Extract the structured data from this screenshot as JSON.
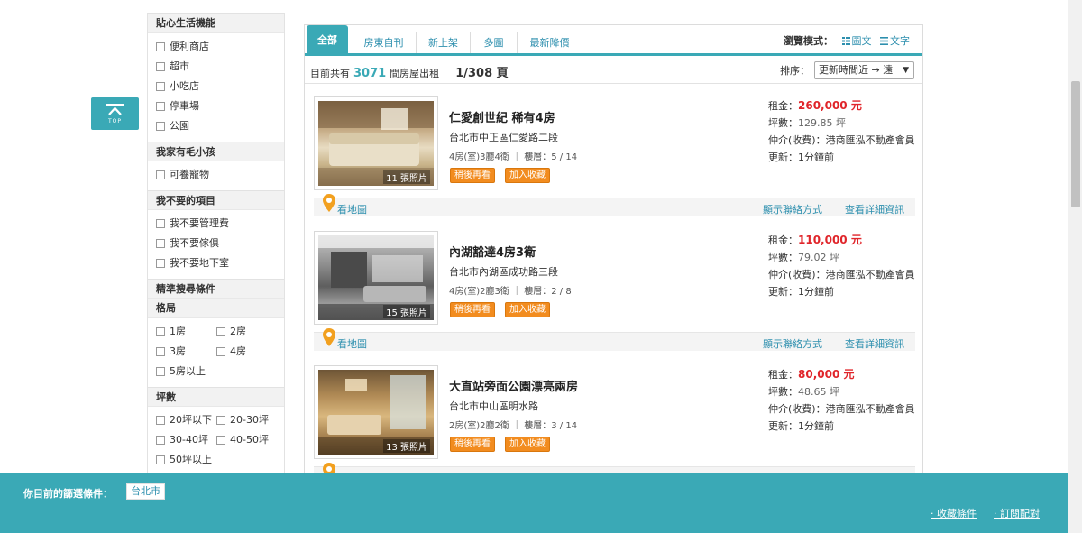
{
  "top_button": {
    "label": "TOP"
  },
  "sidebar": {
    "sections": [
      {
        "title": "貼心生活機能",
        "options": [
          "便利商店",
          "超市",
          "小吃店",
          "停車場",
          "公園"
        ]
      },
      {
        "title": "我家有毛小孩",
        "options": [
          "可養寵物"
        ]
      },
      {
        "title": "我不要的項目",
        "options": [
          "我不要管理費",
          "我不要傢俱",
          "我不要地下室"
        ]
      }
    ],
    "precise_title": "精準搜尋條件",
    "layout": {
      "title": "格局",
      "options": [
        "1房",
        "2房",
        "3房",
        "4房",
        "5房以上"
      ]
    },
    "area": {
      "title": "坪數",
      "options": [
        "20坪以下",
        "20-30坪",
        "30-40坪",
        "40-50坪",
        "50坪以上"
      ]
    }
  },
  "tabs": [
    "全部",
    "房東自刊",
    "新上架",
    "多圖",
    "最新降價"
  ],
  "view_mode": {
    "label": "瀏覽模式：",
    "options": [
      "圖文",
      "文字"
    ]
  },
  "summary": {
    "prefix": "目前共有",
    "count": "3071",
    "suffix": "間房屋出租",
    "pages": "1/308 頁"
  },
  "sort": {
    "label": "排序：",
    "selected": "更新時間近 → 遠"
  },
  "listing_labels": {
    "rent": "租金：",
    "area": "坪數：",
    "agent": "仲介(收費)：",
    "updated": "更新：",
    "later": "稍後再看",
    "fav": "加入收藏",
    "map": "看地圖",
    "contact": "顯示聯絡方式",
    "detail": "查看詳細資訊",
    "price_unit": "元",
    "area_unit": "坪"
  },
  "listings": [
    {
      "title": "仁愛創世紀 稀有4房",
      "address": "台北市中正區仁愛路二段",
      "layout": "4房(室)3廳4衛",
      "floor": "樓層：5 / 14",
      "photos": "11 張照片",
      "price": "260,000",
      "area": "129.85",
      "agent": "港商匯泓不動產會員",
      "updated": "1分鐘前"
    },
    {
      "title": "內湖豁達4房3衛",
      "address": "台北市內湖區成功路三段",
      "layout": "4房(室)2廳3衛",
      "floor": "樓層：2 / 8",
      "photos": "15 張照片",
      "price": "110,000",
      "area": "79.02",
      "agent": "港商匯泓不動產會員",
      "updated": "1分鐘前"
    },
    {
      "title": "大直站旁面公園漂亮兩房",
      "address": "台北市中山區明水路",
      "layout": "2房(室)2廳2衛",
      "floor": "樓層：3 / 14",
      "photos": "13 張照片",
      "price": "80,000",
      "area": "48.65",
      "agent": "港商匯泓不動產會員",
      "updated": "1分鐘前"
    }
  ],
  "bottom_bar": {
    "label": "你目前的篩選條件：",
    "tag": "台北市",
    "links": [
      "收藏條件",
      "訂閱配對"
    ]
  },
  "colors": {
    "accent": "#3aa9b6",
    "link": "#2d8fae",
    "price": "#e0252a",
    "orange": "#f28c1f"
  }
}
